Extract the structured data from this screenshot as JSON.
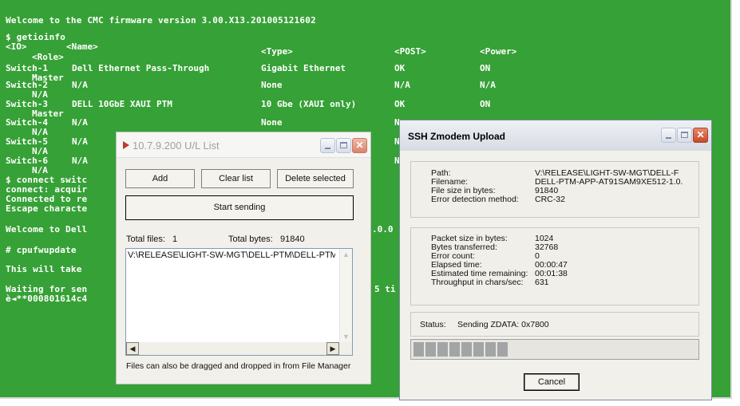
{
  "terminal": {
    "welcome": "Welcome to the CMC firmware version 3.00.X13.201005121602",
    "cmd_getioinfo": "$ getioinfo",
    "headers": {
      "io": "<IO>",
      "name": "<Name>",
      "type": "<Type>",
      "post": "<POST>",
      "power": "<Power>",
      "role": "<Role>"
    },
    "rows": [
      {
        "io": "Switch-1",
        "name": "Dell Ethernet Pass-Through",
        "type": "Gigabit Ethernet",
        "post": "OK",
        "power": "ON",
        "role": "Master"
      },
      {
        "io": "Switch-2",
        "name": "N/A",
        "type": "None",
        "post": "N/A",
        "power": "N/A",
        "role": "N/A"
      },
      {
        "io": "Switch-3",
        "name": "DELL 10GbE XAUI PTM",
        "type": "10 Gbe (XAUI only)",
        "post": "OK",
        "power": "ON",
        "role": "Master"
      },
      {
        "io": "Switch-4",
        "name": "N/A",
        "type": "None",
        "post": "N",
        "power": "",
        "role": "N/A"
      },
      {
        "io": "Switch-5",
        "name": "N/A",
        "type": "",
        "post": "N",
        "power": "",
        "role": "N/A"
      },
      {
        "io": "Switch-6",
        "name": "N/A",
        "type": "",
        "post": "N",
        "power": "",
        "role": "N/A"
      }
    ],
    "connect_line": "$ connect switc",
    "acquire_line": "connect: acquir",
    "connected_line": "Connected to re",
    "escape_line": "Escape characte",
    "welcome_dell": "Welcome to Dell",
    "welcome_dell_tail": ".0.0",
    "cpufwupdate": "# cpufwupdate",
    "this_will": "This will take",
    "waiting": "Waiting for sen",
    "waiting_tail": "5 ti",
    "garbage": "è◄**000801614c4"
  },
  "ul_window": {
    "title": "10.7.9.200 U/L List",
    "add_label": "Add",
    "clear_label": "Clear list",
    "delete_label": "Delete selected",
    "start_label": "Start sending",
    "total_files_label": "Total files:",
    "total_files_value": "1",
    "total_bytes_label": "Total bytes:",
    "total_bytes_value": "91840",
    "list_items": [
      "V:\\RELEASE\\LIGHT-SW-MGT\\DELL-PTM\\DELL-PTM"
    ],
    "hint": "Files can also be dragged and dropped in from File Manager"
  },
  "zmodem_window": {
    "title": "SSH Zmodem Upload",
    "path_label": "Path:",
    "path_value": "V:\\RELEASE\\LIGHT-SW-MGT\\DELL-F",
    "filename_label": "Filename:",
    "filename_value": "DELL-PTM-APP-AT91SAM9XE512-1.0.",
    "filesize_label": "File size in bytes:",
    "filesize_value": "91840",
    "error_method_label": "Error detection method:",
    "error_method_value": "CRC-32",
    "packet_label": "Packet size in bytes:",
    "packet_value": "1024",
    "transferred_label": "Bytes transferred:",
    "transferred_value": "32768",
    "error_count_label": "Error count:",
    "error_count_value": "0",
    "elapsed_label": "Elapsed time:",
    "elapsed_value": "00:00:47",
    "remaining_label": "Estimated time remaining:",
    "remaining_value": "00:01:38",
    "throughput_label": "Throughput in chars/sec:",
    "throughput_value": "631",
    "status_label": "Status:",
    "status_value": "Sending ZDATA: 0x7800",
    "progress_fraction": 0.357,
    "cancel_label": "Cancel"
  }
}
